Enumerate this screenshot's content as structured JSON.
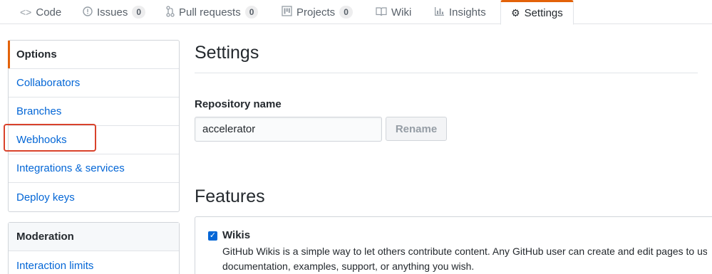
{
  "tabs": [
    {
      "label": "Code",
      "icon": "code-icon"
    },
    {
      "label": "Issues",
      "icon": "issue-icon",
      "count": "0"
    },
    {
      "label": "Pull requests",
      "icon": "pull-request-icon",
      "count": "0"
    },
    {
      "label": "Projects",
      "icon": "project-icon",
      "count": "0"
    },
    {
      "label": "Wiki",
      "icon": "book-icon"
    },
    {
      "label": "Insights",
      "icon": "graph-icon"
    },
    {
      "label": "Settings",
      "icon": "gear-icon",
      "selected": true
    }
  ],
  "sidebar": {
    "items": [
      "Options",
      "Collaborators",
      "Branches",
      "Webhooks",
      "Integrations & services",
      "Deploy keys"
    ],
    "moderation": {
      "heading": "Moderation",
      "items": [
        "Interaction limits"
      ]
    }
  },
  "main": {
    "title": "Settings",
    "repo_label": "Repository name",
    "repo_value": "accelerator",
    "rename_label": "Rename",
    "features_title": "Features",
    "wikis": {
      "title": "Wikis",
      "checked": true,
      "desc_line1": "GitHub Wikis is a simple way to let others contribute content. Any GitHub user can create and edit pages to use f",
      "desc_line2": "documentation, examples, support, or anything you wish."
    }
  },
  "colors": {
    "accent": "#e36209",
    "link": "#0366d6",
    "highlight": "#d9422b"
  }
}
